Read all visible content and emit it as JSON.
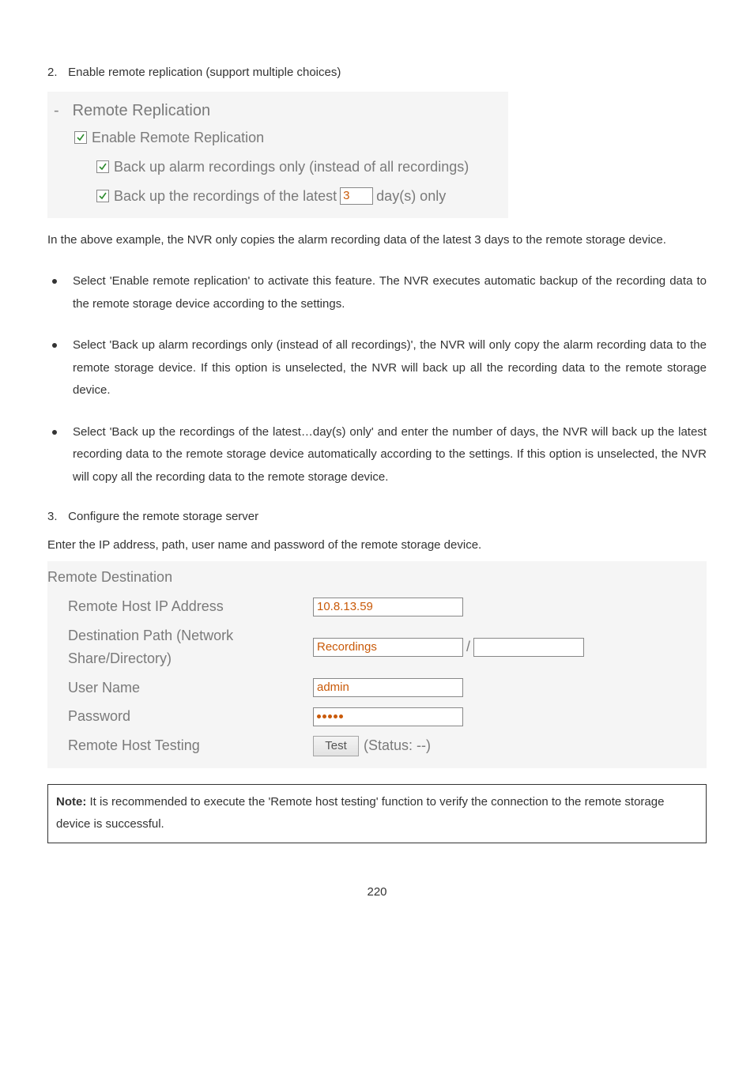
{
  "step2": {
    "num": "2.",
    "text": "Enable remote replication (support multiple choices)"
  },
  "remoteRep": {
    "dash": "-",
    "title": "Remote Replication",
    "row1": "Enable Remote Replication",
    "row2": "Back up alarm recordings only (instead of all recordings)",
    "row3a": "Back up the recordings of the latest",
    "row3_input": "3",
    "row3b": "day(s) only"
  },
  "para1": "In the above example, the NVR only copies the alarm recording data of the latest 3 days to the remote storage device.",
  "bullets": [
    "Select 'Enable remote replication' to activate this feature.   The NVR executes automatic backup of the recording data to the remote storage device according to the settings.",
    "Select 'Back up alarm recordings only (instead of all recordings)', the NVR will only copy the alarm recording data to the remote storage device.   If this option is unselected, the NVR will back up all the recording data to the remote storage device.",
    "Select 'Back up the recordings of the latest…day(s) only' and enter the number of days, the NVR will back up the latest recording data to the remote storage device automatically according to the settings.   If this option is unselected, the NVR will copy all the recording data to the remote storage device."
  ],
  "step3": {
    "num": "3.",
    "text": "Configure the remote storage server"
  },
  "para2": "Enter the IP address, path, user name and password of the remote storage device.",
  "dest": {
    "title": "Remote Destination",
    "ip_label": "Remote Host IP Address",
    "ip_val": "10.8.13.59",
    "path_label": "Destination Path (Network Share/Directory)",
    "path_val": "Recordings",
    "slash": "/",
    "user_label": "User Name",
    "user_val": "admin",
    "pass_label": "Password",
    "test_label": "Remote Host Testing",
    "test_btn": "Test",
    "status": "(Status: --)"
  },
  "note": {
    "bold": "Note:",
    "text": " It is recommended to execute the 'Remote host testing' function to verify the connection to the remote storage device is successful."
  },
  "page_num": "220"
}
